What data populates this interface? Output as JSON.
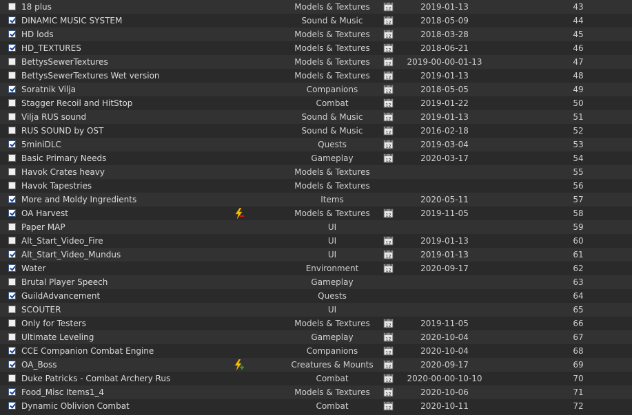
{
  "colors": {
    "row_even": "#2a2a2a",
    "row_odd": "#323232",
    "text": "#dcdcdc",
    "checkmark": "#1f3f8a"
  },
  "icons": {
    "checkbox": "checkbox-icon",
    "calendar": "calendar-icon",
    "flag_warning": "lightning-warning-icon",
    "flag_plus": "lightning-plus-icon"
  },
  "mods": [
    {
      "name": "18 plus",
      "checked": false,
      "category": "Models & Textures",
      "calendar": true,
      "date": "2019-01-13",
      "priority": "43",
      "flag": ""
    },
    {
      "name": "DINAMIC MUSIC SYSTEM",
      "checked": true,
      "category": "Sound & Music",
      "calendar": true,
      "date": "2018-05-09",
      "priority": "44",
      "flag": ""
    },
    {
      "name": "HD lods",
      "checked": true,
      "category": "Models & Textures",
      "calendar": true,
      "date": "2018-03-28",
      "priority": "45",
      "flag": ""
    },
    {
      "name": "HD_TEXTURES",
      "checked": true,
      "category": "Models & Textures",
      "calendar": true,
      "date": "2018-06-21",
      "priority": "46",
      "flag": ""
    },
    {
      "name": "BettysSewerTextures",
      "checked": false,
      "category": "Models & Textures",
      "calendar": true,
      "date": "2019-00-00-01-13",
      "priority": "47",
      "flag": ""
    },
    {
      "name": "BettysSewerTextures Wet version",
      "checked": false,
      "category": "Models & Textures",
      "calendar": true,
      "date": "2019-01-13",
      "priority": "48",
      "flag": ""
    },
    {
      "name": "Soratnik Vilja",
      "checked": true,
      "category": "Companions",
      "calendar": true,
      "date": "2018-05-05",
      "priority": "49",
      "flag": ""
    },
    {
      "name": "Stagger Recoil and HitStop",
      "checked": false,
      "category": "Combat",
      "calendar": true,
      "date": "2019-01-22",
      "priority": "50",
      "flag": ""
    },
    {
      "name": "Vilja RUS sound",
      "checked": false,
      "category": "Sound & Music",
      "calendar": true,
      "date": "2019-01-13",
      "priority": "51",
      "flag": ""
    },
    {
      "name": "RUS SOUND by OST",
      "checked": false,
      "category": "Sound & Music",
      "calendar": true,
      "date": "2016-02-18",
      "priority": "52",
      "flag": ""
    },
    {
      "name": "5miniDLC",
      "checked": true,
      "category": "Quests",
      "calendar": true,
      "date": "2019-03-04",
      "priority": "53",
      "flag": ""
    },
    {
      "name": "Basic Primary Needs",
      "checked": false,
      "category": "Gameplay",
      "calendar": true,
      "date": "2020-03-17",
      "priority": "54",
      "flag": ""
    },
    {
      "name": "Havok Crates heavy",
      "checked": false,
      "category": "Models & Textures",
      "calendar": false,
      "date": "",
      "priority": "55",
      "flag": ""
    },
    {
      "name": "Havok Tapestries",
      "checked": false,
      "category": "Models & Textures",
      "calendar": false,
      "date": "",
      "priority": "56",
      "flag": ""
    },
    {
      "name": "More and Moldy Ingredients",
      "checked": true,
      "category": "Items",
      "calendar": false,
      "date": "2020-05-11",
      "priority": "57",
      "flag": ""
    },
    {
      "name": "OA Harvest",
      "checked": true,
      "category": "Models & Textures",
      "calendar": true,
      "date": "2019-11-05",
      "priority": "58",
      "flag": "warning"
    },
    {
      "name": "Paper MAP",
      "checked": false,
      "category": "UI",
      "calendar": false,
      "date": "",
      "priority": "59",
      "flag": ""
    },
    {
      "name": "Alt_Start_Video_Fire",
      "checked": false,
      "category": "UI",
      "calendar": true,
      "date": "2019-01-13",
      "priority": "60",
      "flag": ""
    },
    {
      "name": "Alt_Start_Video_Mundus",
      "checked": true,
      "category": "UI",
      "calendar": true,
      "date": "2019-01-13",
      "priority": "61",
      "flag": ""
    },
    {
      "name": "Water",
      "checked": true,
      "category": "Environment",
      "calendar": true,
      "date": "2020-09-17",
      "priority": "62",
      "flag": ""
    },
    {
      "name": "Brutal Player Speech",
      "checked": false,
      "category": "Gameplay",
      "calendar": false,
      "date": "",
      "priority": "63",
      "flag": ""
    },
    {
      "name": "GuildAdvancement",
      "checked": true,
      "category": "Quests",
      "calendar": false,
      "date": "",
      "priority": "64",
      "flag": ""
    },
    {
      "name": "SCOUTER",
      "checked": false,
      "category": "UI",
      "calendar": false,
      "date": "",
      "priority": "65",
      "flag": ""
    },
    {
      "name": "Only for Testers",
      "checked": false,
      "category": "Models & Textures",
      "calendar": true,
      "date": "2019-11-05",
      "priority": "66",
      "flag": ""
    },
    {
      "name": "Ultimate Leveling",
      "checked": false,
      "category": "Gameplay",
      "calendar": true,
      "date": "2020-10-04",
      "priority": "67",
      "flag": ""
    },
    {
      "name": "CCE Companion Combat Engine",
      "checked": true,
      "category": "Companions",
      "calendar": true,
      "date": "2020-10-04",
      "priority": "68",
      "flag": ""
    },
    {
      "name": "OA_Boss",
      "checked": true,
      "category": "Creatures & Mounts",
      "calendar": true,
      "date": "2020-09-17",
      "priority": "69",
      "flag": "plus"
    },
    {
      "name": "Duke Patricks - Combat Archery Rus",
      "checked": false,
      "category": "Combat",
      "calendar": true,
      "date": "2020-00-00-10-10",
      "priority": "70",
      "flag": ""
    },
    {
      "name": "Food_Misc Items1_4",
      "checked": true,
      "category": "Models & Textures",
      "calendar": true,
      "date": "2020-10-06",
      "priority": "71",
      "flag": ""
    },
    {
      "name": "Dynamic Oblivion Combat",
      "checked": true,
      "category": "Combat",
      "calendar": true,
      "date": "2020-10-11",
      "priority": "72",
      "flag": ""
    }
  ]
}
